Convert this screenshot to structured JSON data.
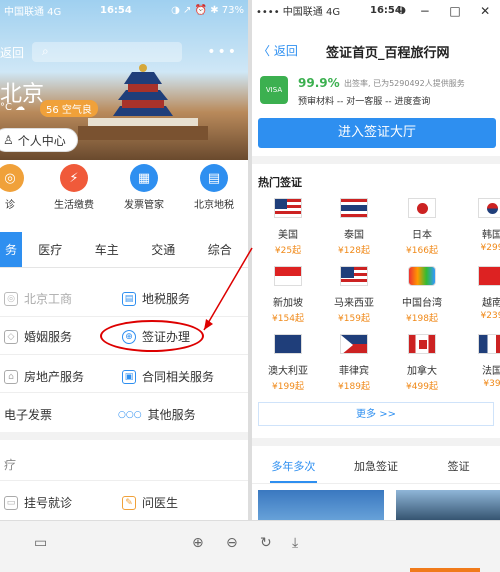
{
  "window": {
    "minimize": "−",
    "maximize": "□",
    "close": "✕"
  },
  "left": {
    "status": {
      "carrier": "中国联通 4G",
      "time": "16:54",
      "right": "◑ ↗ ⏰ ✱ 73%"
    },
    "back": "返回",
    "more": "•••",
    "city": "北京",
    "temp": "°C ☁",
    "aqi": "56 空气良",
    "center": "个人中心",
    "icons": [
      {
        "label": "诊",
        "color": "#f0a13a",
        "glyph": "◎"
      },
      {
        "label": "生活缴费",
        "color": "#f05a3a",
        "glyph": "⚡"
      },
      {
        "label": "发票管家",
        "color": "#2e8ff0",
        "glyph": "▦"
      },
      {
        "label": "北京地税",
        "color": "#2e8ff0",
        "glyph": "▤"
      }
    ],
    "tabs": [
      "务",
      "医疗",
      "车主",
      "交通",
      "综合"
    ],
    "services": [
      {
        "label": "北京工商",
        "gray": true
      },
      {
        "label": "地税服务"
      },
      {
        "label": "婚姻服务"
      },
      {
        "label": "签证办理"
      },
      {
        "label": "房地产服务"
      },
      {
        "label": "合同相关服务"
      },
      {
        "label": "电子发票"
      },
      {
        "label": "其他服务"
      }
    ],
    "section": "疗",
    "bottom_items": [
      {
        "label": "挂号就诊"
      },
      {
        "label": "问医生"
      }
    ]
  },
  "right": {
    "status": {
      "carrier": "•••• 中国联通 4G",
      "time": "16:54",
      "right": "◑ ↗ ⏰ ✱ 73%"
    },
    "back": "〈 返回",
    "title": "签证首页_百程旅行网",
    "visa_icon": "VISA",
    "pct": "99.9%",
    "stat": "出签率, 已为5290492人提供服务",
    "svc": "预审材料 -- 对一客服 -- 进度查询",
    "cta": "进入签证大厅",
    "hot": "热门签证",
    "countries": [
      {
        "name": "美国",
        "price": "¥25起"
      },
      {
        "name": "泰国",
        "price": "¥128起"
      },
      {
        "name": "日本",
        "price": "¥166起"
      },
      {
        "name": "韩国",
        "price": "¥299"
      },
      {
        "name": "新加坡",
        "price": "¥154起"
      },
      {
        "name": "马来西亚",
        "price": "¥159起"
      },
      {
        "name": "中国台湾",
        "price": "¥198起"
      },
      {
        "name": "越南",
        "price": "¥239"
      },
      {
        "name": "澳大利亚",
        "price": "¥199起"
      },
      {
        "name": "菲律宾",
        "price": "¥189起"
      },
      {
        "name": "加拿大",
        "price": "¥499起"
      },
      {
        "name": "法国",
        "price": "¥39"
      }
    ],
    "more": "更多 >>",
    "tabs": [
      "多年多次",
      "加急签证",
      "签证"
    ]
  },
  "toolbar": {
    "icons": [
      "▭",
      "⊕",
      "⊖",
      "↻",
      "⤓"
    ]
  }
}
